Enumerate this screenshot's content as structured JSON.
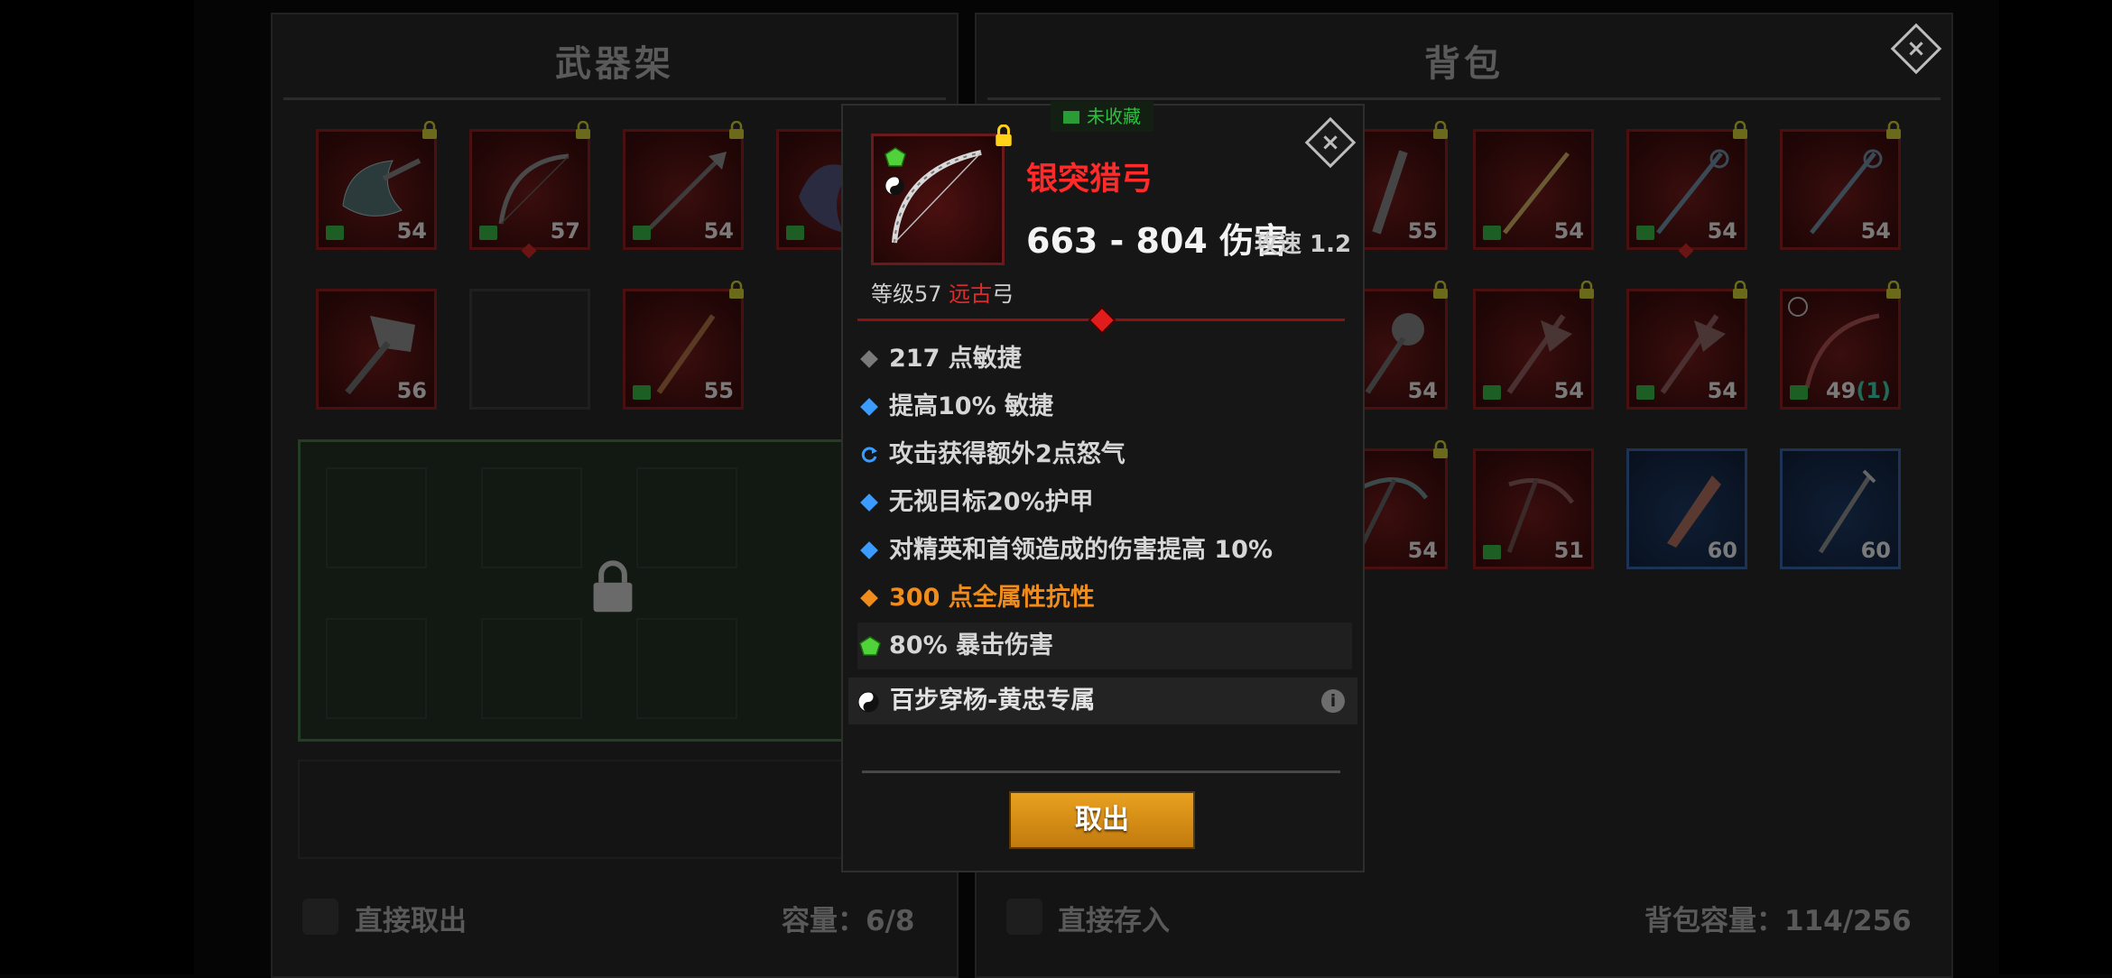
{
  "colors": {
    "legendary_red": "#ff2a2a",
    "orange_stat": "#f08c1c",
    "blue_stat": "#3a9cff",
    "button_orange": "#e8a11f",
    "collect_green": "#2fbf3f"
  },
  "weapon_rack": {
    "title": "武器架",
    "slots": [
      {
        "level": "54",
        "icon": "axe-icon"
      },
      {
        "level": "57",
        "icon": "bow-icon"
      },
      {
        "level": "54",
        "icon": "spear-icon"
      },
      {
        "level": "",
        "icon": "axe-icon"
      },
      {
        "level": "56",
        "icon": "hammer-icon"
      },
      {
        "level": "55",
        "icon": "sword-icon"
      }
    ],
    "footer_label": "直接取出",
    "capacity": "容量：6/8"
  },
  "backpack": {
    "title": "背包",
    "slots": [
      {
        "level": "55",
        "icon": "sword-icon"
      },
      {
        "level": "54",
        "icon": "sword-icon"
      },
      {
        "level": "54",
        "icon": "staff-icon"
      },
      {
        "level": "54",
        "icon": "staff-icon"
      },
      {
        "level": "54",
        "icon": "mace-icon"
      },
      {
        "level": "54",
        "icon": "polearm-icon"
      },
      {
        "level": "54",
        "icon": "polearm-icon"
      },
      {
        "level": "49",
        "extra": "(1)",
        "icon": "bow-icon"
      },
      {
        "level": "54",
        "icon": "scythe-icon"
      },
      {
        "level": "51",
        "icon": "scythe-icon"
      },
      {
        "level": "60",
        "icon": "dagger-icon"
      },
      {
        "level": "60",
        "icon": "staff-icon"
      }
    ],
    "footer_label": "直接存入",
    "capacity": "背包容量：114/256"
  },
  "popup": {
    "collect_status": "未收藏",
    "name": "银突猎弓",
    "damage": "663 - 804 伤害",
    "speed": "攻速 1.2",
    "level_prefix": "等级57 ",
    "rarity": "远古",
    "weapon_type": "弓",
    "stats": [
      {
        "text": "217 点敏捷",
        "icon": "gray-diamond-icon"
      },
      {
        "text": "提高10% 敏捷",
        "icon": "blue-diamond-icon"
      },
      {
        "text": "攻击获得额外2点怒气",
        "icon": "refresh-icon"
      },
      {
        "text": "无视目标20%护甲",
        "icon": "blue-diamond-icon"
      },
      {
        "text": "对精英和首领造成的伤害提高 10%",
        "icon": "blue-diamond-icon"
      },
      {
        "text": "300 点全属性抗性",
        "icon": "orange-diamond-icon"
      },
      {
        "text": "80% 暴击伤害",
        "icon": "green-gem-icon"
      }
    ],
    "set_bonus": "百步穿杨-黄忠专属",
    "take_button": "取出",
    "close_label": "×"
  }
}
